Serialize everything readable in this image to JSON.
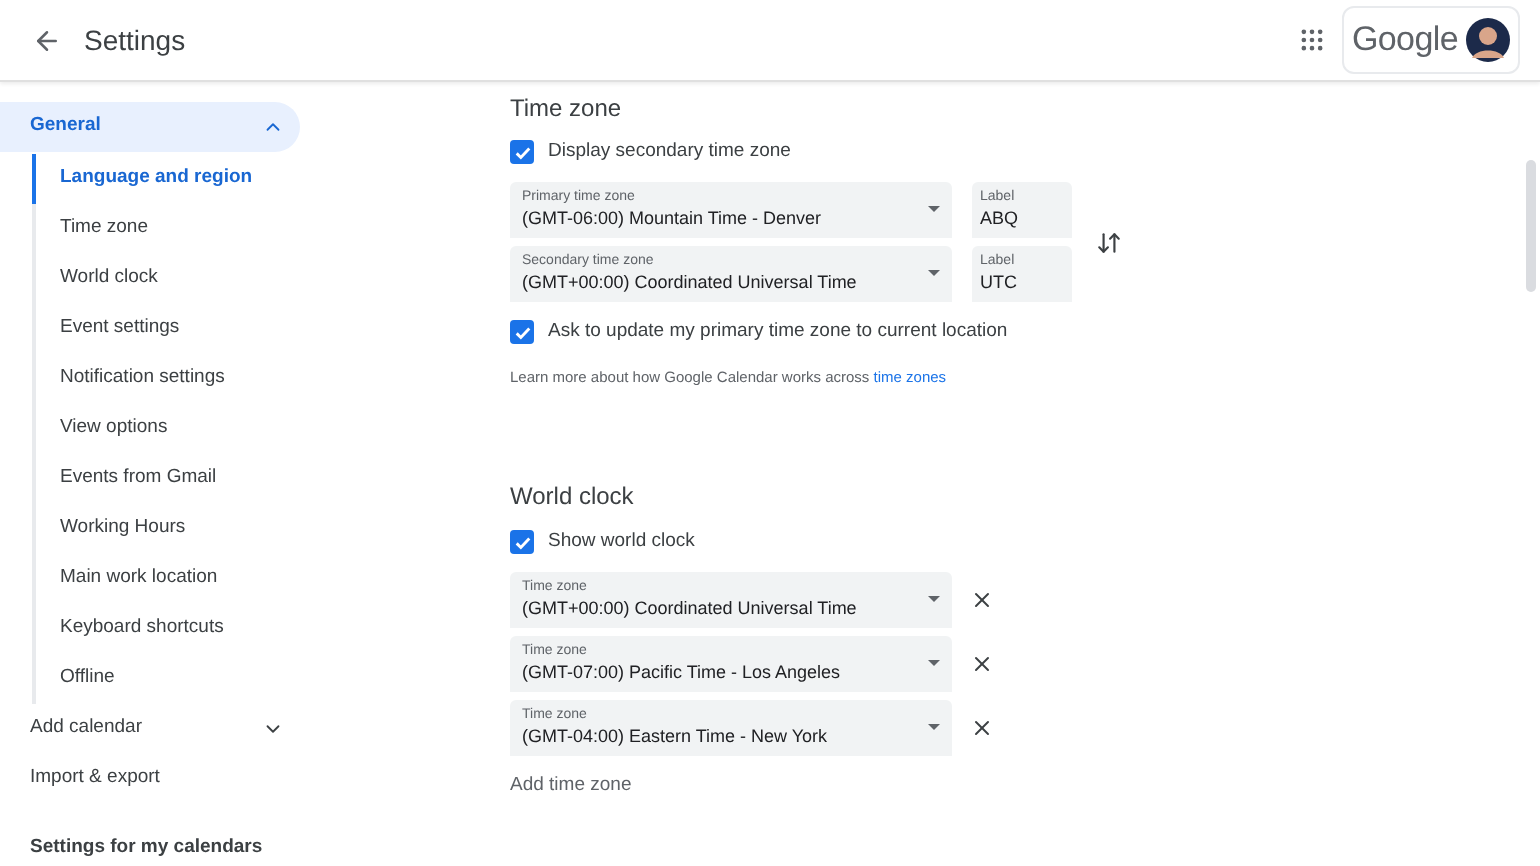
{
  "header": {
    "title": "Settings",
    "brand": "Google"
  },
  "sidebar": {
    "items": [
      {
        "label": "General",
        "kind": "group",
        "selected": true,
        "expanded": true,
        "children": [
          {
            "label": "Language and region",
            "selected": true
          },
          {
            "label": "Time zone",
            "selected": false
          },
          {
            "label": "World clock",
            "selected": false
          },
          {
            "label": "Event settings",
            "selected": false
          },
          {
            "label": "Notification settings",
            "selected": false
          },
          {
            "label": "View options",
            "selected": false
          },
          {
            "label": "Events from Gmail",
            "selected": false
          },
          {
            "label": "Working Hours",
            "selected": false
          },
          {
            "label": "Main work location",
            "selected": false
          },
          {
            "label": "Keyboard shortcuts",
            "selected": false
          },
          {
            "label": "Offline",
            "selected": false
          }
        ]
      },
      {
        "label": "Add calendar",
        "kind": "group",
        "selected": false,
        "expanded": false
      },
      {
        "label": "Import & export",
        "kind": "link",
        "selected": false
      }
    ],
    "section_heading": "Settings for my calendars"
  },
  "time_zone": {
    "title": "Time zone",
    "display_secondary": {
      "label": "Display secondary time zone",
      "checked": true
    },
    "zones": [
      {
        "caption": "Primary time zone",
        "value": "(GMT-06:00) Mountain Time - Denver",
        "label_caption": "Label",
        "label_value": "ABQ"
      },
      {
        "caption": "Secondary time zone",
        "value": "(GMT+00:00) Coordinated Universal Time",
        "label_caption": "Label",
        "label_value": "UTC"
      }
    ],
    "ask_update": {
      "label": "Ask to update my primary time zone to current location",
      "checked": true
    },
    "learn_more": {
      "text": "Learn more about how Google Calendar works across",
      "link": "time zones"
    }
  },
  "world_clock": {
    "title": "World clock",
    "show": {
      "label": "Show world clock",
      "checked": true
    },
    "zones": [
      {
        "caption": "Time zone",
        "value": "(GMT+00:00) Coordinated Universal Time"
      },
      {
        "caption": "Time zone",
        "value": "(GMT-07:00) Pacific Time - Los Angeles"
      },
      {
        "caption": "Time zone",
        "value": "(GMT-04:00) Eastern Time - New York"
      }
    ],
    "add": "Add time zone"
  }
}
